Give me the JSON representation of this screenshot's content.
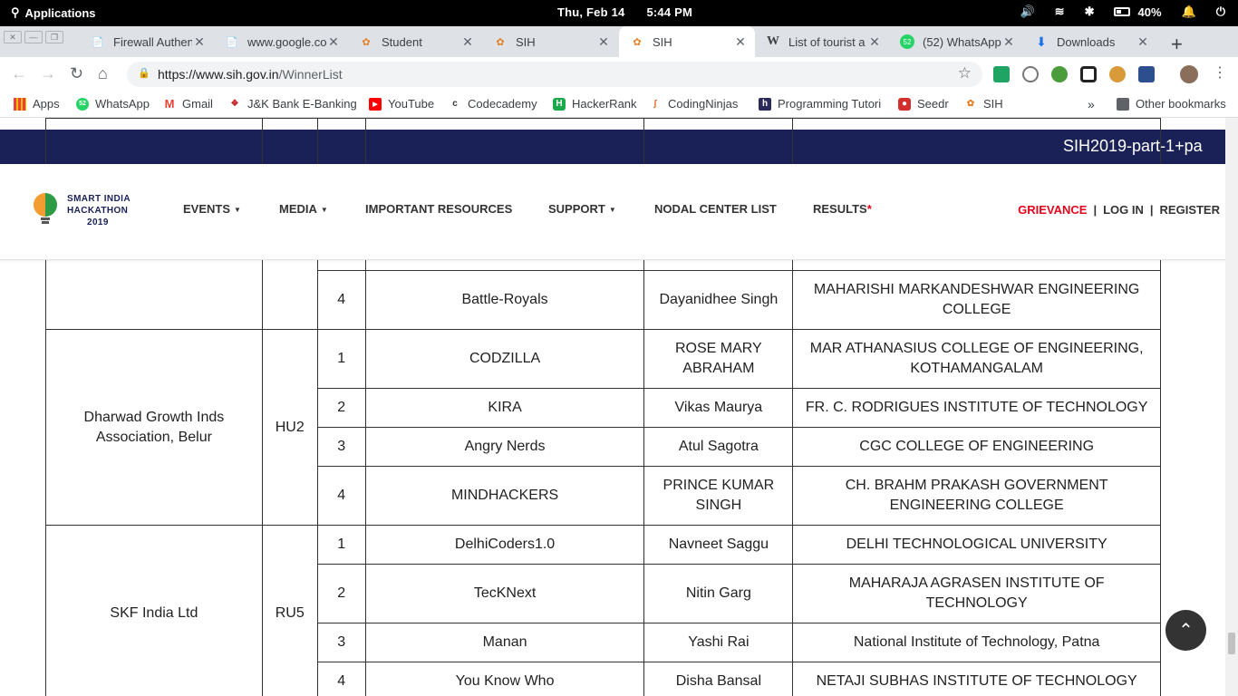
{
  "system_bar": {
    "apps_label": "Applications",
    "day_date": "Thu, Feb 14",
    "time": "5:44 PM",
    "battery_percent": "40%"
  },
  "tabs": [
    {
      "title": "Firewall Authen",
      "icon": "page-icon"
    },
    {
      "title": "www.google.co",
      "icon": "page-icon"
    },
    {
      "title": "Student",
      "icon": "sih-icon"
    },
    {
      "title": "SIH",
      "icon": "sih-icon"
    },
    {
      "title": "SIH",
      "icon": "sih-icon",
      "active": true
    },
    {
      "title": "List of tourist a",
      "icon": "wikipedia-icon"
    },
    {
      "title": "(52) WhatsApp",
      "icon": "whatsapp-icon"
    },
    {
      "title": "Downloads",
      "icon": "download-icon"
    }
  ],
  "address_bar": {
    "url_host": "https://www.sih.gov.in",
    "url_path": "/WinnerList"
  },
  "bookmarks": [
    {
      "label": "Apps"
    },
    {
      "label": "WhatsApp"
    },
    {
      "label": "Gmail"
    },
    {
      "label": "J&K Bank E-Banking"
    },
    {
      "label": "YouTube"
    },
    {
      "label": "Codecademy"
    },
    {
      "label": "HackerRank"
    },
    {
      "label": "CodingNinjas"
    },
    {
      "label": "Programming Tutori"
    },
    {
      "label": "Seedr"
    },
    {
      "label": "SIH"
    }
  ],
  "other_bookmarks": "Other bookmarks",
  "ticker_text": "SIH2019-part-1+pa",
  "site_header": {
    "logo_line1": "SMART INDIA",
    "logo_line2": "HACKATHON",
    "logo_line3": "2019",
    "menu": {
      "events": "EVENTS",
      "media": "MEDIA",
      "resources": "IMPORTANT RESOURCES",
      "support": "SUPPORT",
      "nodal": "NODAL CENTER LIST",
      "results": "RESULTS",
      "results_mark": "*"
    },
    "grievance": "GRIEVANCE",
    "login": "LOG IN",
    "register": "REGISTER",
    "separator": "|"
  },
  "winners": {
    "top_partial_row": {
      "rank": "4",
      "team": "Battle-Royals",
      "leader": "Dayanidhee Singh",
      "college": "MAHARISHI MARKANDESHWAR ENGINEERING COLLEGE"
    },
    "groups": [
      {
        "organization": "Dharwad Growth Inds Association, Belur",
        "code": "HU2",
        "rows": [
          {
            "rank": "1",
            "team": "CODZILLA",
            "leader": "ROSE MARY ABRAHAM",
            "college": "MAR ATHANASIUS COLLEGE OF ENGINEERING, KOTHAMANGALAM"
          },
          {
            "rank": "2",
            "team": "KIRA",
            "leader": "Vikas Maurya",
            "college": "FR. C. RODRIGUES INSTITUTE OF TECHNOLOGY"
          },
          {
            "rank": "3",
            "team": "Angry Nerds",
            "leader": "Atul Sagotra",
            "college": "CGC COLLEGE OF ENGINEERING"
          },
          {
            "rank": "4",
            "team": "MINDHACKERS",
            "leader": "PRINCE KUMAR SINGH",
            "college": "CH. BRAHM PRAKASH GOVERNMENT ENGINEERING COLLEGE"
          }
        ]
      },
      {
        "organization": "SKF India Ltd",
        "code": "RU5",
        "rows": [
          {
            "rank": "1",
            "team": "DelhiCoders1.0",
            "leader": "Navneet Saggu",
            "college": "DELHI TECHNOLOGICAL UNIVERSITY"
          },
          {
            "rank": "2",
            "team": "TecKNext",
            "leader": "Nitin Garg",
            "college": "MAHARAJA AGRASEN INSTITUTE OF TECHNOLOGY"
          },
          {
            "rank": "3",
            "team": "Manan",
            "leader": "Yashi Rai",
            "college": "National Institute of Technology, Patna"
          },
          {
            "rank": "4",
            "team": "You Know Who",
            "leader": "Disha Bansal",
            "college": "NETAJI SUBHAS INSTITUTE OF TECHNOLOGY"
          }
        ]
      }
    ]
  },
  "colors": {
    "ticker_bg": "#1a2156",
    "grievance": "#e3051b",
    "back_to_top": "#333333"
  }
}
